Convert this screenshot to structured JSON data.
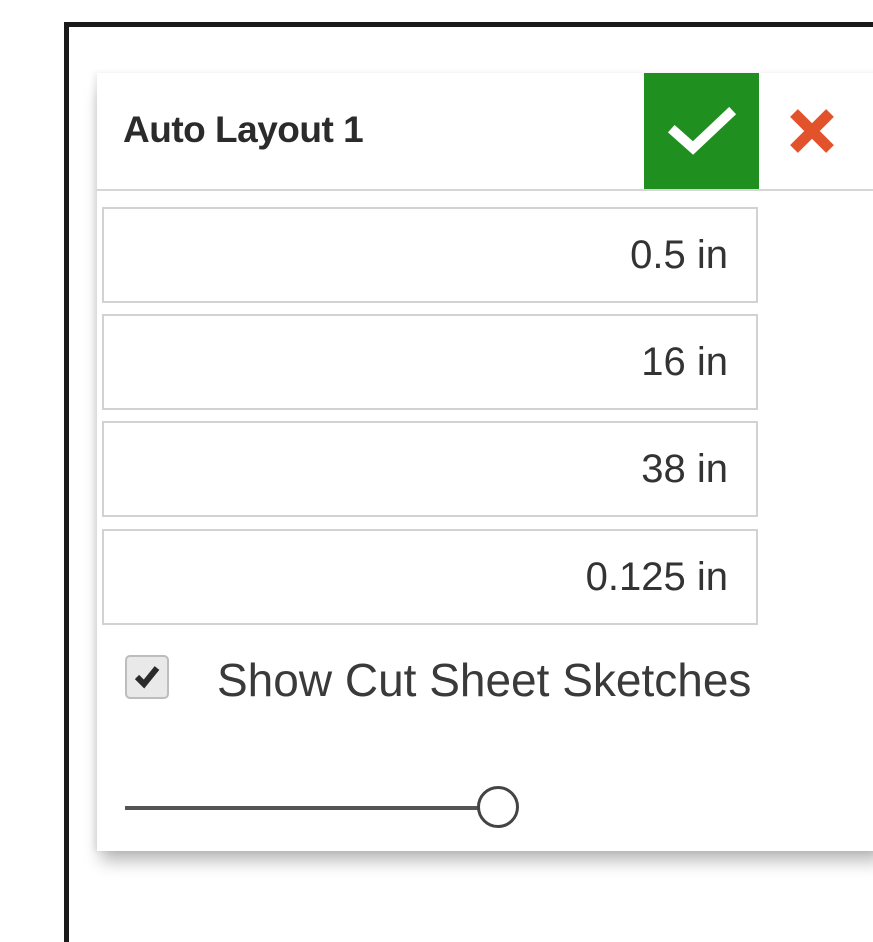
{
  "dialog": {
    "title": "Auto Layout 1",
    "ok_icon": "checkmark-icon",
    "cancel_icon": "close-icon",
    "colors": {
      "ok_background": "#1f8f1f",
      "cancel_color": "#e2532b"
    }
  },
  "fields": [
    {
      "value": "0.5 in"
    },
    {
      "value": "16 in"
    },
    {
      "value": "38 in"
    },
    {
      "value": "0.125 in"
    }
  ],
  "options": {
    "show_cut_sheet_sketches": {
      "label": "Show Cut Sheet Sketches",
      "checked": true
    }
  },
  "slider": {
    "level": 0.95
  }
}
